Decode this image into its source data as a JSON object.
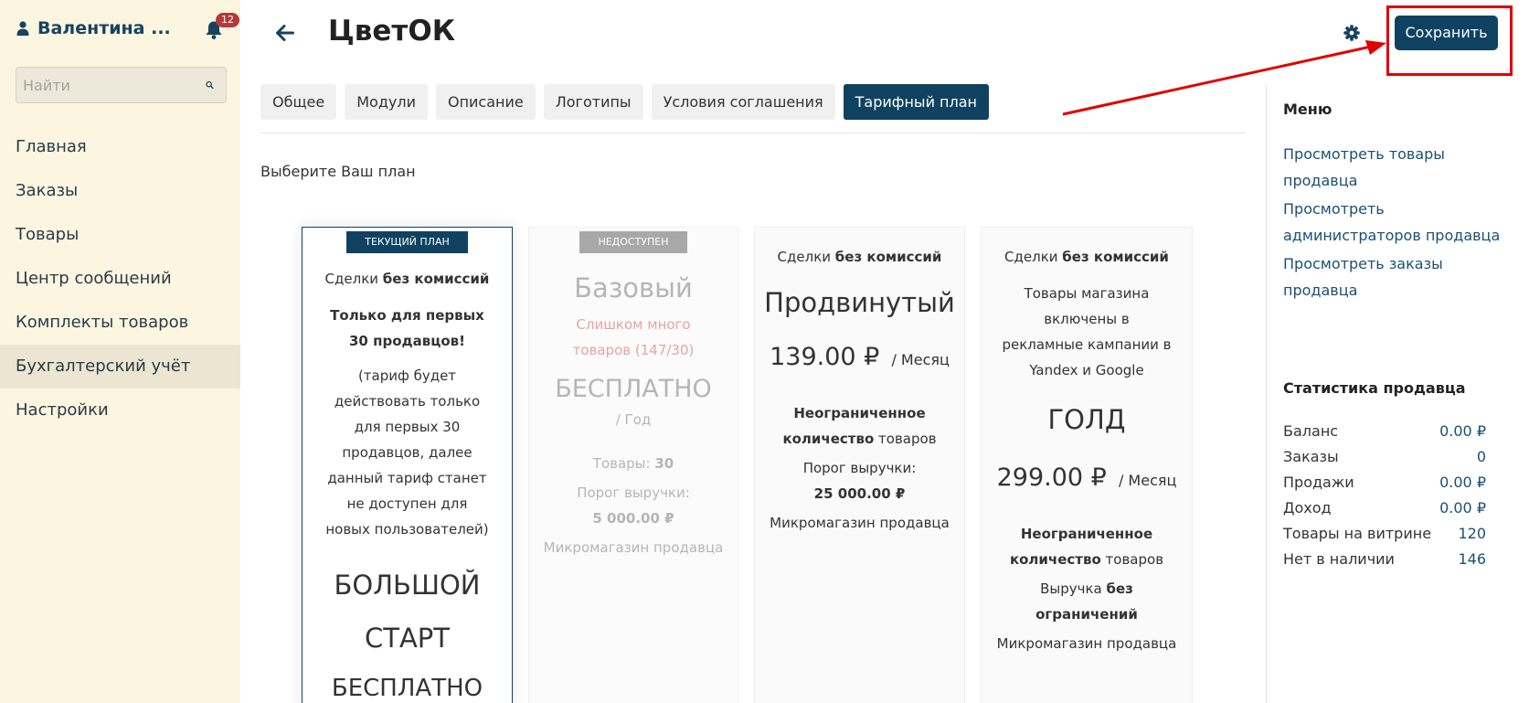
{
  "sidebar": {
    "user_name": "Валентина ...",
    "notifications_count": "12",
    "search_placeholder": "Найти",
    "items": [
      {
        "label": "Главная",
        "active": false
      },
      {
        "label": "Заказы",
        "active": false
      },
      {
        "label": "Товары",
        "active": false
      },
      {
        "label": "Центр сообщений",
        "active": false
      },
      {
        "label": "Комплекты товаров",
        "active": false
      },
      {
        "label": "Бухгалтерский учёт",
        "active": true
      },
      {
        "label": "Настройки",
        "active": false
      }
    ]
  },
  "header": {
    "title": "ЦветОК",
    "save_label": "Сохранить"
  },
  "tabs": [
    {
      "label": "Общее",
      "active": false
    },
    {
      "label": "Модули",
      "active": false
    },
    {
      "label": "Описание",
      "active": false
    },
    {
      "label": "Логотипы",
      "active": false
    },
    {
      "label": "Условия соглашения",
      "active": false
    },
    {
      "label": "Тарифный план",
      "active": true
    }
  ],
  "content": {
    "prompt": "Выберите Ваш план",
    "plans": {
      "current": {
        "badge": "ТЕКУЩИЙ ПЛАН",
        "deals_prefix": "Сделки ",
        "deals_bold": "без комиссий",
        "limited_note": "Только для первых 30 продавцов!",
        "description": "(тариф будет действовать только для первых 30 продавцов, далее данный тариф станет не доступен для новых пользователей)",
        "name": "БОЛЬШОЙ СТАРТ",
        "price": "БЕСПЛАТНО"
      },
      "basic": {
        "badge": "НЕДОСТУПЕН",
        "name": "Базовый",
        "warning": "Слишком много товаров (147/30)",
        "price": "БЕСПЛАТНО",
        "period": "/ Год",
        "products_label": "Товары: ",
        "products_value": "30",
        "revenue_label": "Порог выручки:",
        "revenue_value": "5 000.00 ₽",
        "feature": "Микромагазин продавца"
      },
      "advanced": {
        "deals_prefix": "Сделки ",
        "deals_bold": "без комиссий",
        "name": "Продвинутый",
        "price": "139.00 ₽",
        "period": "/ Месяц",
        "products_bold": "Неограниченное количество",
        "products_suffix": " товаров",
        "revenue_label": "Порог выручки:",
        "revenue_value": "25 000.00 ₽",
        "feature": "Микромагазин продавца"
      },
      "gold": {
        "deals_prefix": "Сделки ",
        "deals_bold": "без комиссий",
        "ads_text": "Товары магазина включены в рекламные кампании в Yandex и Google",
        "name": "ГОЛД",
        "price": "299.00 ₽",
        "period": "/ Месяц",
        "products_bold": "Неограниченное количество",
        "products_suffix": " товаров",
        "revenue_prefix": "Выручка ",
        "revenue_bold": "без ограничений",
        "feature": "Микромагазин продавца"
      }
    }
  },
  "rightcol": {
    "menu_title": "Меню",
    "links": [
      "Просмотреть товары продавца",
      "Просмотреть администраторов продавца",
      "Просмотреть заказы продавца"
    ],
    "stats_title": "Статистика продавца",
    "stats": [
      {
        "label": "Баланс",
        "value": "0.00 ₽"
      },
      {
        "label": "Заказы",
        "value": "0"
      },
      {
        "label": "Продажи",
        "value": "0.00 ₽"
      },
      {
        "label": "Доход",
        "value": "0.00 ₽"
      },
      {
        "label": "Товары на витрине",
        "value": "120"
      },
      {
        "label": "Нет в наличии",
        "value": "146"
      }
    ]
  },
  "colors": {
    "primary": "#0f4260",
    "sidebar_bg": "#fcf5e0",
    "link": "#1b4f72",
    "annotation": "#e00000",
    "badge_red": "#b33a3a"
  },
  "icons": [
    "user-icon",
    "bell-icon",
    "search-icon",
    "back-arrow-icon",
    "gear-icon"
  ]
}
